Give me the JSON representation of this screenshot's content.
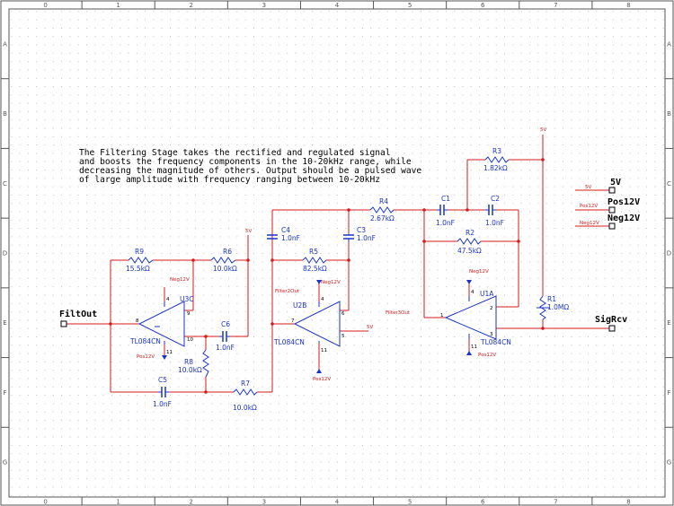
{
  "border": {
    "col_labels": [
      "0",
      "1",
      "2",
      "3",
      "4",
      "5",
      "6",
      "7",
      "8"
    ],
    "row_labels": [
      "A",
      "B",
      "C",
      "D",
      "E",
      "F",
      "G"
    ]
  },
  "description": [
    "The Filtering Stage takes the rectified and regulated signal",
    "and boosts the frequency components in the 10-20kHz range, while",
    "decreasing the magnitude of others. Output should be a pulsed wave",
    "of large amplitude with frequency ranging between 10-20kHz"
  ],
  "ports": {
    "filtout": "FiltOut",
    "sigrcv": "SigRcv",
    "v5": "5V",
    "pos12": "Pos12V",
    "neg12": "Neg12V"
  },
  "nets": {
    "v5": "5V",
    "pos12": "Pos12V",
    "neg12": "Neg12V",
    "filter2out": "Filter2Out",
    "filter3out": "Filter3Out"
  },
  "components": {
    "R9": {
      "ref": "R9",
      "value": "15.5kΩ"
    },
    "R6": {
      "ref": "R6",
      "value": "10.0kΩ"
    },
    "R8": {
      "ref": "R8",
      "value": "10.0kΩ"
    },
    "R7": {
      "ref": "R7",
      "value": "10.0kΩ"
    },
    "R5": {
      "ref": "R5",
      "value": "82.5kΩ"
    },
    "R4": {
      "ref": "R4",
      "value": "2.67kΩ"
    },
    "R3": {
      "ref": "R3",
      "value": "1.82kΩ"
    },
    "R2": {
      "ref": "R2",
      "value": "47.5kΩ"
    },
    "R1": {
      "ref": "R1",
      "value": "1.0MΩ"
    },
    "C1": {
      "ref": "C1",
      "value": "1.0nF"
    },
    "C2": {
      "ref": "C2",
      "value": "1.0nF"
    },
    "C3": {
      "ref": "C3",
      "value": "1.0nF"
    },
    "C4": {
      "ref": "C4",
      "value": "1.0nF"
    },
    "C5": {
      "ref": "C5",
      "value": "1.0nF"
    },
    "C6": {
      "ref": "C6",
      "value": "1.0nF"
    },
    "U3C": {
      "ref": "U3C",
      "part": "TL084CN",
      "pin_minus": "9",
      "pin_plus": "10",
      "pin_out": "8",
      "pin_v1": "4",
      "pin_v2": "11"
    },
    "U2B": {
      "ref": "U2B",
      "part": "TL084CN",
      "pin_minus": "6",
      "pin_plus": "5",
      "pin_out": "7",
      "pin_v1": "4",
      "pin_v2": "11"
    },
    "U1A": {
      "ref": "U1A",
      "part": "TL084CN",
      "pin_minus": "2",
      "pin_plus": "3",
      "pin_out": "1",
      "pin_v1": "4",
      "pin_v2": "11"
    }
  },
  "colors": {
    "wire": "#d81b1b",
    "component": "#1a33c8",
    "border": "#555555",
    "grid": "#bdbdbd",
    "text": "#000000"
  }
}
